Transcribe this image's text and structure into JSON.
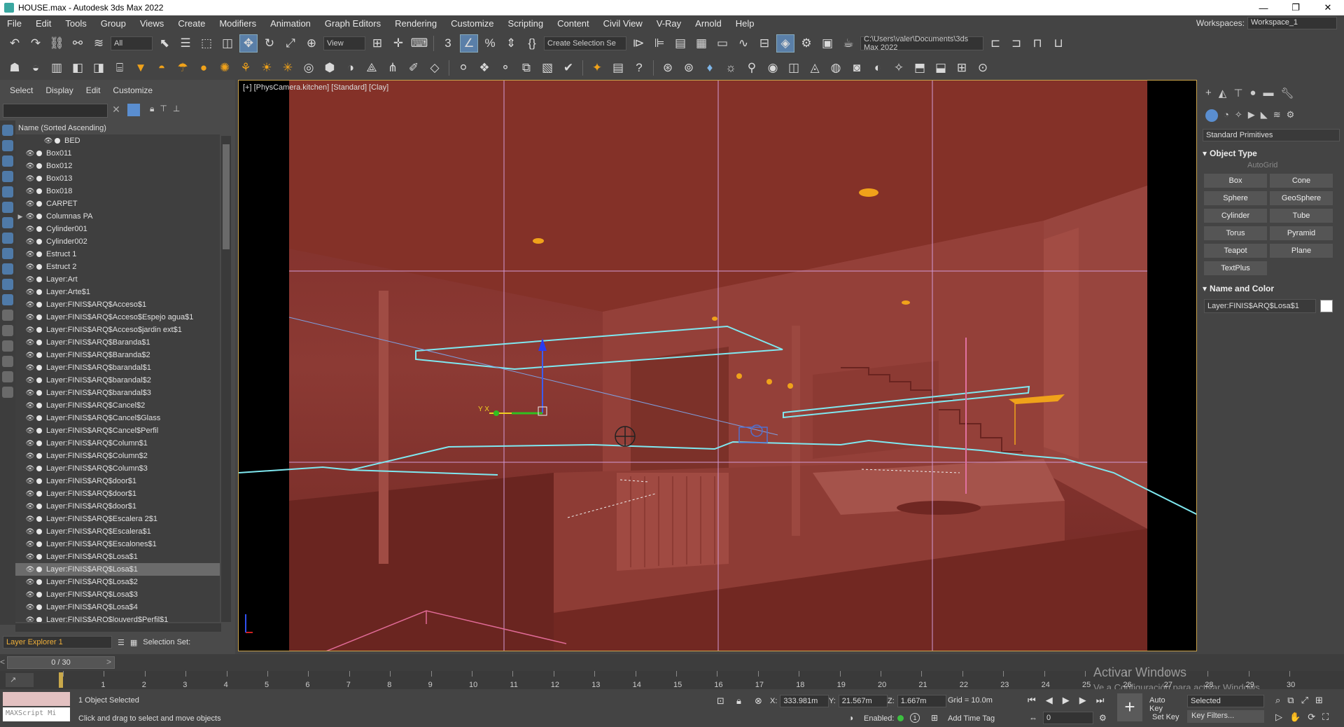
{
  "window": {
    "title": "HOUSE.max - Autodesk 3ds Max 2022",
    "controls": [
      "—",
      "❐",
      "✕"
    ]
  },
  "menu": [
    "File",
    "Edit",
    "Tools",
    "Group",
    "Views",
    "Create",
    "Modifiers",
    "Animation",
    "Graph Editors",
    "Rendering",
    "Customize",
    "Scripting",
    "Content",
    "Civil View",
    "V-Ray",
    "Arnold",
    "Help"
  ],
  "workspace": {
    "label": "Workspaces:",
    "value": "Workspace_1"
  },
  "toolbar": {
    "filter_value": "All",
    "refcoord_value": "View",
    "selection_set_placeholder": "Create Selection Se",
    "path_value": "C:\\Users\\valer\\Documents\\3ds Max 2022"
  },
  "scene_explorer": {
    "tabs": [
      "Select",
      "Display",
      "Edit",
      "Customize"
    ],
    "column_header": "Name (Sorted Ascending)",
    "rows": [
      {
        "name": "BED",
        "indent": true
      },
      {
        "name": "Box011"
      },
      {
        "name": "Box012"
      },
      {
        "name": "Box013"
      },
      {
        "name": "Box018"
      },
      {
        "name": "CARPET"
      },
      {
        "name": "Columnas PA",
        "group": true
      },
      {
        "name": "Cylinder001"
      },
      {
        "name": "Cylinder002"
      },
      {
        "name": "Estruct 1"
      },
      {
        "name": "Estruct 2"
      },
      {
        "name": "Layer:Art"
      },
      {
        "name": "Layer:Arte$1"
      },
      {
        "name": "Layer:FINIS$ARQ$Acceso$1"
      },
      {
        "name": "Layer:FINIS$ARQ$Acceso$Espejo agua$1"
      },
      {
        "name": "Layer:FINIS$ARQ$Acceso$jardin ext$1"
      },
      {
        "name": "Layer:FINIS$ARQ$Baranda$1"
      },
      {
        "name": "Layer:FINIS$ARQ$Baranda$2"
      },
      {
        "name": "Layer:FINIS$ARQ$barandal$1"
      },
      {
        "name": "Layer:FINIS$ARQ$barandal$2"
      },
      {
        "name": "Layer:FINIS$ARQ$barandal$3"
      },
      {
        "name": "Layer:FINIS$ARQ$Cancel$2"
      },
      {
        "name": "Layer:FINIS$ARQ$Cancel$Glass"
      },
      {
        "name": "Layer:FINIS$ARQ$Cancel$Perfil"
      },
      {
        "name": "Layer:FINIS$ARQ$Column$1"
      },
      {
        "name": "Layer:FINIS$ARQ$Column$2"
      },
      {
        "name": "Layer:FINIS$ARQ$Column$3"
      },
      {
        "name": "Layer:FINIS$ARQ$door$1"
      },
      {
        "name": "Layer:FINIS$ARQ$door$1"
      },
      {
        "name": "Layer:FINIS$ARQ$door$1"
      },
      {
        "name": "Layer:FINIS$ARQ$Escalera 2$1"
      },
      {
        "name": "Layer:FINIS$ARQ$Escalera$1"
      },
      {
        "name": "Layer:FINIS$ARQ$Escalones$1"
      },
      {
        "name": "Layer:FINIS$ARQ$Losa$1"
      },
      {
        "name": "Layer:FINIS$ARQ$Losa$1",
        "selected": true
      },
      {
        "name": "Layer:FINIS$ARQ$Losa$2"
      },
      {
        "name": "Layer:FINIS$ARQ$Losa$3"
      },
      {
        "name": "Layer:FINIS$ARQ$Losa$4"
      },
      {
        "name": "Layer:FINIS$ARQ$louverd$Perfil$1"
      }
    ],
    "layer_explorer": "Layer Explorer 1",
    "selection_set_label": "Selection Set:"
  },
  "viewport": {
    "label": "[+] [PhysCamera.kitchen] [Standard] [Clay]"
  },
  "command_panel": {
    "category": "Standard Primitives",
    "object_type_title": "Object Type",
    "autogrid": "AutoGrid",
    "buttons": [
      "Box",
      "Cone",
      "Sphere",
      "GeoSphere",
      "Cylinder",
      "Tube",
      "Torus",
      "Pyramid",
      "Teapot",
      "Plane",
      "TextPlus"
    ],
    "name_color_title": "Name and Color",
    "object_name": "Layer:FINIS$ARQ$Losa$1"
  },
  "timeline": {
    "slider": "0 / 30",
    "ticks": [
      "0",
      "1",
      "2",
      "3",
      "4",
      "5",
      "6",
      "7",
      "8",
      "9",
      "10",
      "11",
      "12",
      "13",
      "14",
      "15",
      "16",
      "17",
      "18",
      "19",
      "20",
      "21",
      "22",
      "23",
      "24",
      "25",
      "26",
      "27",
      "28",
      "29",
      "30"
    ]
  },
  "status": {
    "selected": "1 Object Selected",
    "hint": "Click and drag to select and move objects",
    "maxscript": "MAXScript Mi",
    "x_label": "X:",
    "x": "333.981m",
    "y_label": "Y:",
    "y": "21.567m",
    "z_label": "Z:",
    "z": "1.667m",
    "grid": "Grid = 10.0m",
    "enabled": "Enabled:",
    "add_time_tag": "Add Time Tag",
    "auto_key": "Auto Key",
    "set_key": "Set Key",
    "selected_dd": "Selected",
    "key_filters": "Key Filters...",
    "frame": "0"
  },
  "watermark": {
    "line1": "Activar Windows",
    "line2": "Ve a Configuración para activar Windows."
  },
  "colors": {
    "viewport_bg": "#7a2a26",
    "selection": "#7fe8f0",
    "accent": "#5a8ed0"
  }
}
